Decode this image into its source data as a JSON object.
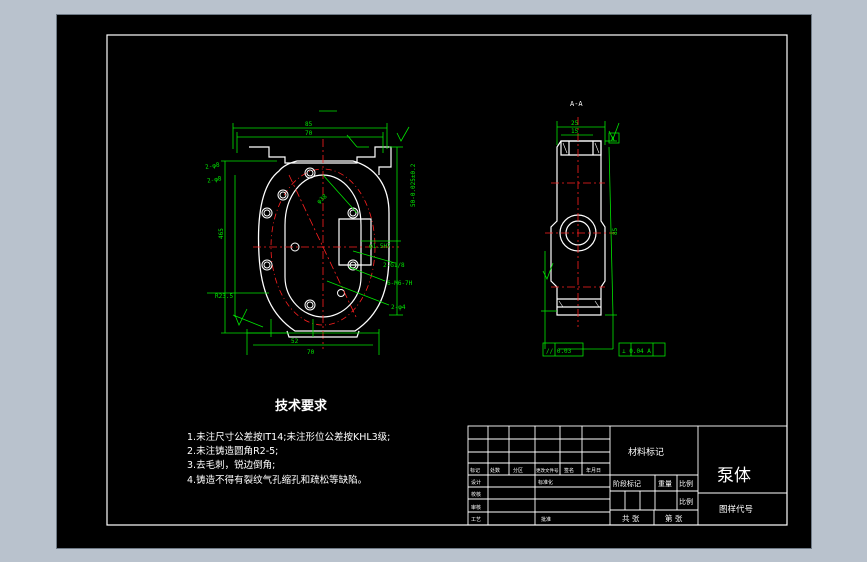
{
  "colors": {
    "background_outer": "#b9c2cd",
    "sheet": "#000000",
    "part_outline": "#ffffff",
    "dimension": "#00e600",
    "center_line": "#ff2020",
    "frame": "#ffffff"
  },
  "section_label": "A-A",
  "tech_requirements": {
    "title": "技术要求",
    "items": [
      "1.未注尺寸公差按IT14;未注形位公差按KHL3级;",
      "2.未注铸造圆角R2-5;",
      "3.去毛刺，锐边倒角;",
      "4.铸造不得有裂纹气孔缩孔和疏松等缺陷。"
    ]
  },
  "title_block": {
    "material_label": "材料标记",
    "part_name": "泵体",
    "drawing_code_label": "图样代号",
    "stage_mark_label": "阶段标记",
    "weight_label": "重量",
    "scale_label": "比例",
    "scale_label_2": "比例",
    "sheets_total": "共  张",
    "sheet_no": "第  张",
    "rev_headers": [
      "标记",
      "处数",
      "分区",
      "更改文件号",
      "签名",
      "年月日"
    ],
    "rows": [
      "设计",
      "校核",
      "审核",
      "工艺"
    ],
    "standardize": "标准化",
    "approve": "批准"
  },
  "dimensions": {
    "front_width_top": "85",
    "front_width_inner": "70",
    "front_width_bottom": "70",
    "front_width_inner_bottom": "52",
    "front_height_left": "465",
    "front_left_top_1": "2-φ8",
    "front_left_top_2": "2-φ8",
    "front_right_vertical": "50-0.025±0.2",
    "front_center_dim": "φ38",
    "front_label_1": "φ1.5H7",
    "front_label_2": "2-G1/8",
    "front_label_3": "6-M6-7H",
    "front_label_4": "2-φ4",
    "front_left_r": "R23.5",
    "section_width_top": "25",
    "section_width_inner": "15",
    "section_height_right": "85",
    "tol_frame_left": "// 0.03",
    "tol_frame_right": "⊥ 0.04 A",
    "tol_ref_right": "A"
  }
}
